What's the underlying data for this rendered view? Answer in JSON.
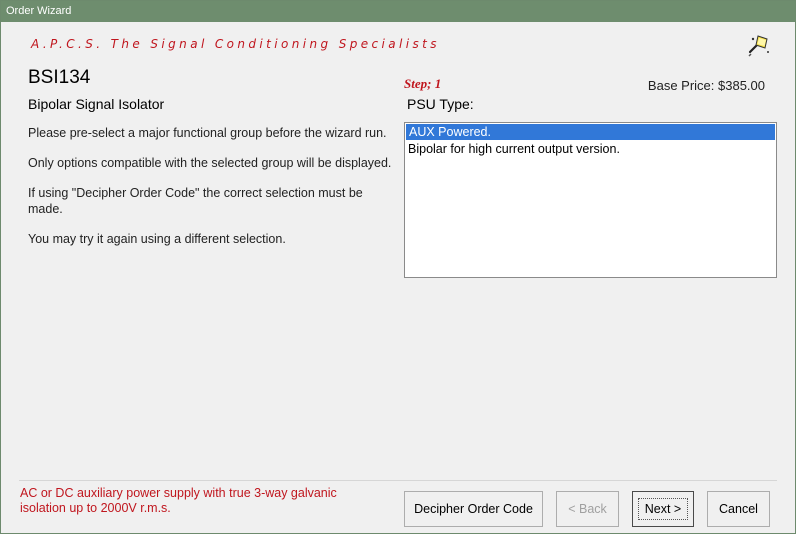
{
  "window": {
    "title": "Order Wizard"
  },
  "header": {
    "brand": "A.P.C.S. The Signal Conditioning Specialists",
    "icon": "wizard-icon"
  },
  "product": {
    "code": "BSI134",
    "name": "Bipolar Signal Isolator",
    "base_price": "Base Price: $385.00"
  },
  "step": {
    "label": "Step; 1",
    "option_title": "PSU Type:"
  },
  "instructions": [
    "Please pre-select a major functional group before the wizard run.",
    "Only options compatible with the selected group will be displayed.",
    "If using \"Decipher Order Code\" the correct selection must be made.",
    "You may try it again using a different selection."
  ],
  "options": [
    {
      "label": "AUX Powered.",
      "selected": true
    },
    {
      "label": "Bipolar for high current output version.",
      "selected": false
    }
  ],
  "description": "AC or DC auxiliary power supply with true 3-way galvanic isolation up to 2000V r.m.s.",
  "buttons": {
    "decipher": "Decipher Order Code",
    "back": "< Back",
    "next": "Next >",
    "cancel": "Cancel"
  },
  "colors": {
    "titlebar": "#6e8d6e",
    "accent_red": "#c0161e",
    "selection": "#3178d8"
  }
}
